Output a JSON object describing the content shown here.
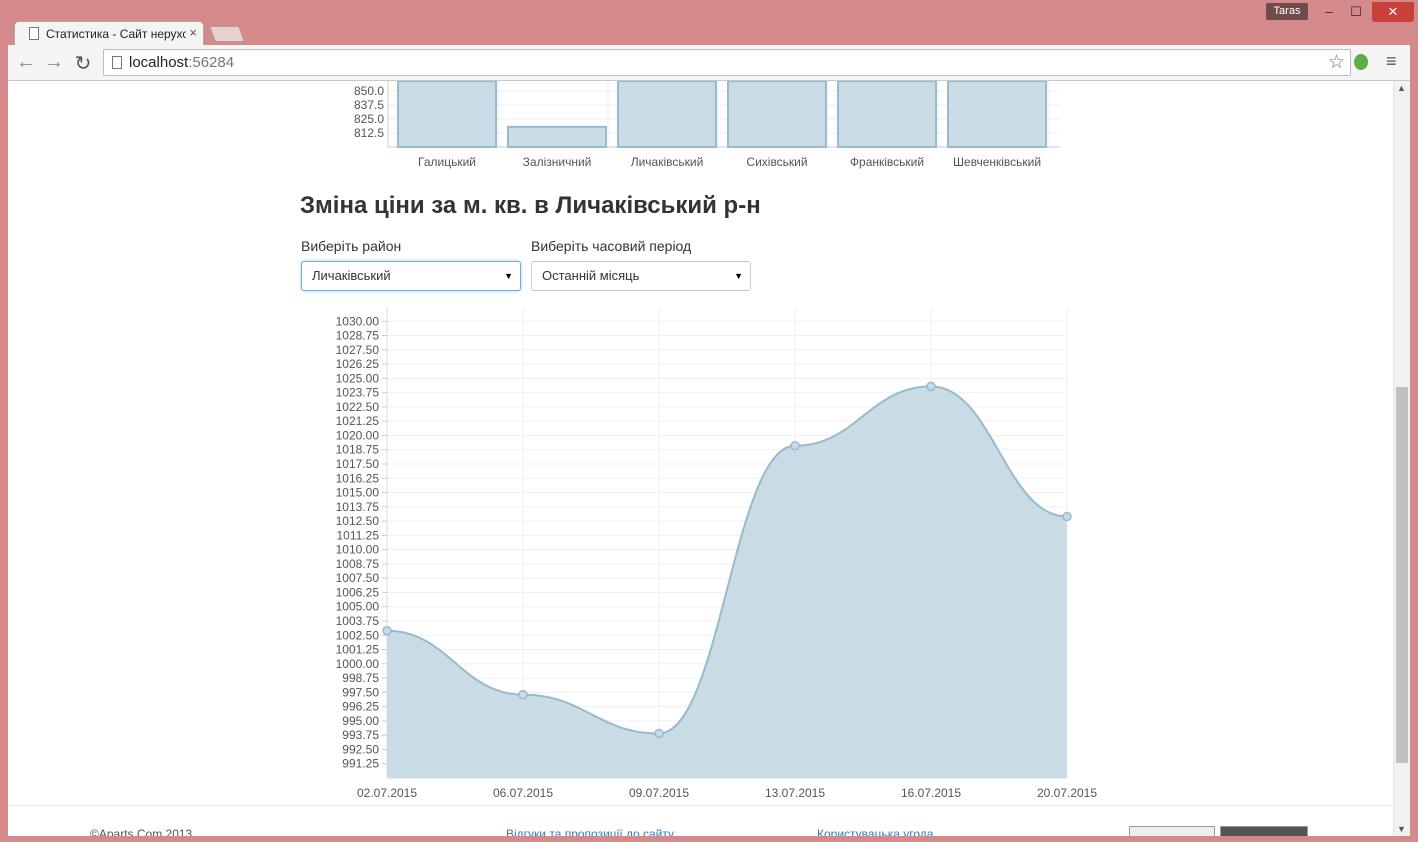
{
  "window": {
    "user": "Taras",
    "minimize": "–",
    "maximize": "☐",
    "close": "✕"
  },
  "browser": {
    "tab_title": "Статистика - Сайт нерухо",
    "tab_close": "×",
    "url_host": "localhost",
    "url_port": ":56284",
    "back": "←",
    "forward": "→",
    "reload": "↻",
    "star": "☆",
    "menu": "≡"
  },
  "top_chart": {
    "type": "bar",
    "y_ticks": [
      "850.0",
      "837.5",
      "825.0",
      "812.5"
    ],
    "categories": [
      "Галицький",
      "Залізничний",
      "Личаківський",
      "Сихівський",
      "Франківський",
      "Шевченківський"
    ],
    "values": [
      860,
      818,
      860,
      860,
      860,
      860
    ]
  },
  "heading": "Зміна ціни за м. кв. в Личаківський р-н",
  "filters": {
    "district_label": "Виберіть район",
    "district_value": "Личаківський",
    "period_label": "Виберіть часовий період",
    "period_value": "Останній місяць"
  },
  "chart_data": {
    "type": "area",
    "x": [
      "02.07.2015",
      "06.07.2015",
      "09.07.2015",
      "13.07.2015",
      "16.07.2015",
      "20.07.2015"
    ],
    "values": [
      1002.9,
      997.3,
      993.9,
      1019.1,
      1024.3,
      1012.9
    ],
    "ylim": [
      990.0,
      1031.25
    ],
    "y_ticks": [
      "1030.00",
      "1028.75",
      "1027.50",
      "1026.25",
      "1025.00",
      "1023.75",
      "1022.50",
      "1021.25",
      "1020.00",
      "1018.75",
      "1017.50",
      "1016.25",
      "1015.00",
      "1013.75",
      "1012.50",
      "1011.25",
      "1010.00",
      "1008.75",
      "1007.50",
      "1006.25",
      "1005.00",
      "1003.75",
      "1002.50",
      "1001.25",
      "1000.00",
      "998.75",
      "997.50",
      "996.25",
      "995.00",
      "993.75",
      "992.50",
      "991.25"
    ],
    "grid": true,
    "fill_color": "#c9dbe5",
    "line_color": "#97bbcd"
  },
  "footer": {
    "copyright": "©Aparts.Com 2013",
    "link1": "Відгуки та пропозиції до сайту",
    "link2": "Користувацька угода"
  }
}
